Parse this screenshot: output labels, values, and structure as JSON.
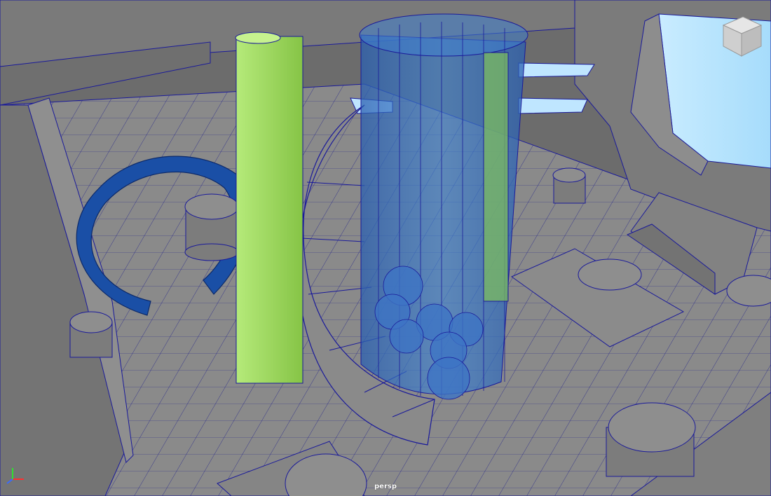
{
  "viewport": {
    "camera_label": "persp",
    "view_cube": {
      "faces": [
        "TOP",
        "FRONT",
        "RIGHT"
      ]
    },
    "axis_indicator": {
      "axes": [
        "x",
        "y",
        "z"
      ],
      "colors": {
        "x": "#ff3030",
        "y": "#30e030",
        "z": "#3a6aff"
      }
    }
  },
  "scene": {
    "wireframe_color": "#1a1a9a",
    "shaded_color": "#858585",
    "floor_color": "#8a8a8a",
    "selected_cylinder_color": "#9ed75a",
    "glass_color": "#3a78c8",
    "ring_color": "#1a4fa6",
    "window_color": "#bfe6ff"
  }
}
